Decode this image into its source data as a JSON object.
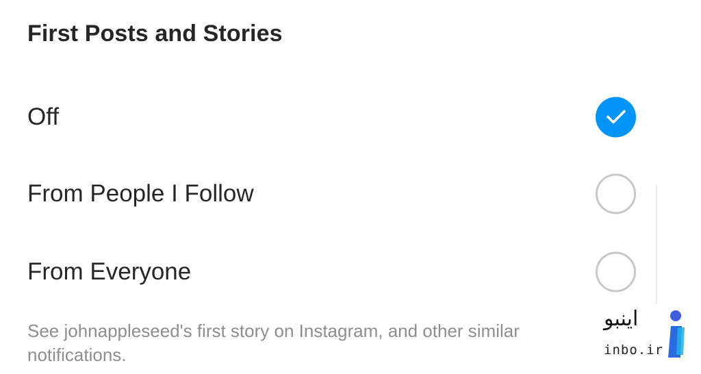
{
  "section": {
    "title": "First Posts and Stories"
  },
  "options": [
    {
      "label": "Off",
      "selected": true
    },
    {
      "label": "From People I Follow",
      "selected": false
    },
    {
      "label": "From Everyone",
      "selected": false
    }
  ],
  "helper": {
    "text": "See johnappleseed's first story on Instagram, and other similar notifications."
  },
  "watermark": {
    "persian": "اینبو",
    "domain": "inbo.ir",
    "logo_icon": "inbo-logo-icon"
  },
  "colors": {
    "accent": "#0095f6",
    "radio_border": "#c7c7c7",
    "text_primary": "#262626",
    "text_secondary": "#8e8e8e",
    "watermark_blue": "#2b6be0"
  },
  "icons": {
    "check": "check-icon"
  }
}
